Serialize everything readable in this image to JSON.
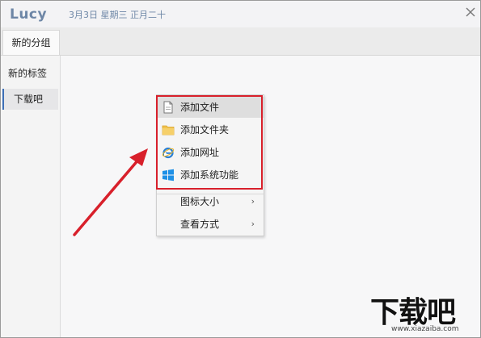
{
  "app": {
    "name": "Lucy",
    "date": "3月3日 星期三 正月二十"
  },
  "tabs": [
    {
      "label": "新的分组"
    }
  ],
  "sidebar": {
    "items": [
      {
        "label": "新的标签"
      },
      {
        "label": "下载吧"
      }
    ]
  },
  "context_menu": {
    "items": [
      {
        "label": "添加文件",
        "icon": "file-icon"
      },
      {
        "label": "添加文件夹",
        "icon": "folder-icon"
      },
      {
        "label": "添加网址",
        "icon": "ie-browser-icon"
      },
      {
        "label": "添加系统功能",
        "icon": "windows-icon"
      },
      {
        "label": "图标大小",
        "submenu": "›"
      },
      {
        "label": "查看方式",
        "submenu": "›"
      }
    ]
  },
  "annotation": {
    "color": "#d8202b"
  },
  "watermark": {
    "logo": "下载吧",
    "url": "www.xiazaiba.com"
  },
  "colors": {
    "accent": "#3d6fb6",
    "title": "#6d86a6"
  }
}
